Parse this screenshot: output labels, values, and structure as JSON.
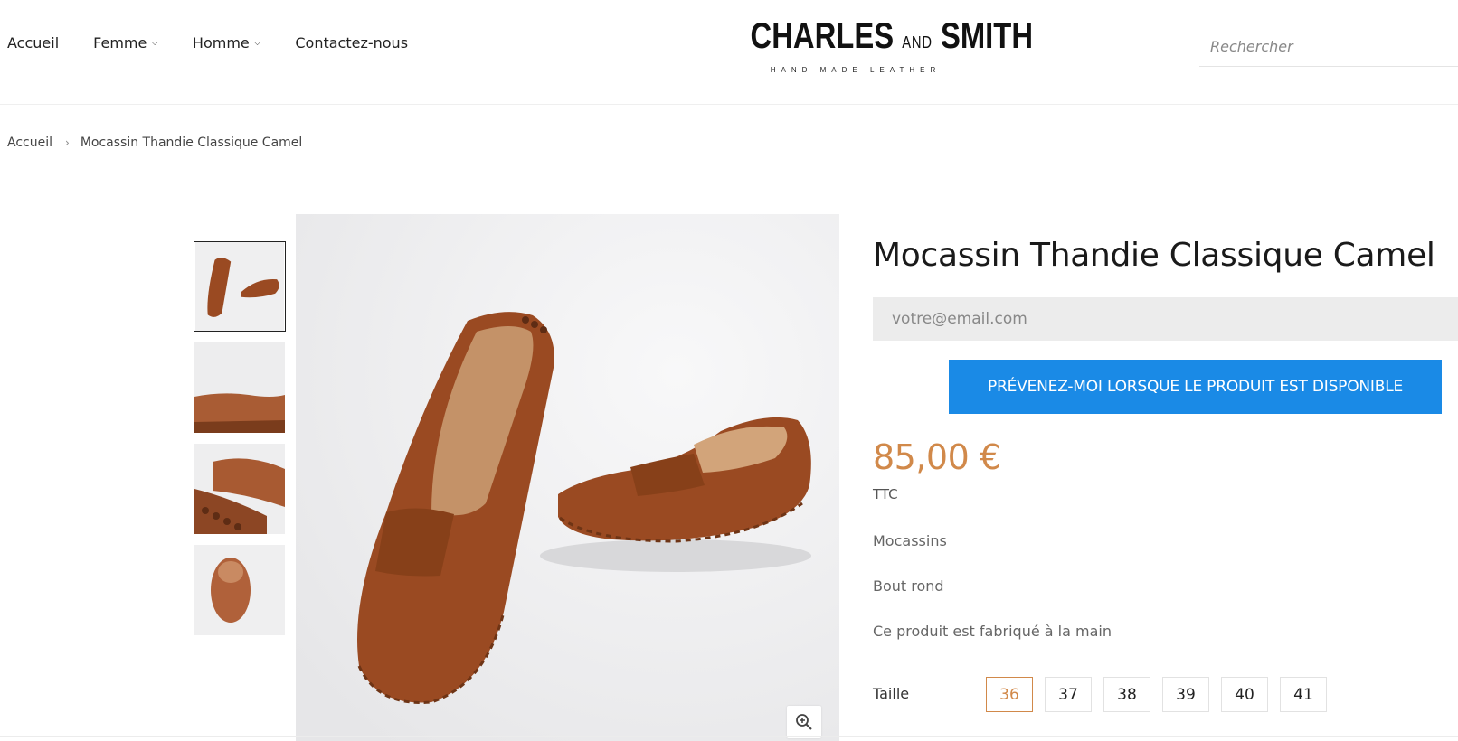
{
  "header": {
    "nav": [
      {
        "label": "Accueil",
        "has_dropdown": false
      },
      {
        "label": "Femme",
        "has_dropdown": true
      },
      {
        "label": "Homme",
        "has_dropdown": true
      },
      {
        "label": "Contactez-nous",
        "has_dropdown": false
      }
    ],
    "logo": {
      "word1": "CHARLES",
      "and": "AND",
      "word2": "SMITH",
      "tagline": "HAND MADE LEATHER"
    },
    "search": {
      "placeholder": "Rechercher"
    }
  },
  "breadcrumb": {
    "home": "Accueil",
    "separator": "›",
    "current": "Mocassin Thandie Classique Camel"
  },
  "gallery": {
    "thumbnail_count": 4,
    "active_index": 0
  },
  "product": {
    "title": "Mocassin Thandie Classique Camel",
    "email_placeholder": "votre@email.com",
    "notify_label": "PRÉVENEZ-MOI LORSQUE LE PRODUIT EST DISPONIBLE",
    "price": "85,00 €",
    "tax_note": "TTC",
    "features": [
      "Mocassins",
      "Bout rond",
      "Ce produit est fabriqué à la main"
    ],
    "size_label": "Taille",
    "sizes": [
      "36",
      "37",
      "38",
      "39",
      "40",
      "41"
    ],
    "selected_size": "36"
  },
  "colors": {
    "accent_price": "#d1894a",
    "button_blue": "#1a8ae6",
    "suede_camel": "#9a4a22"
  },
  "icons": {
    "zoom": "zoom-in-icon",
    "dropdown": "chevron-down-icon"
  }
}
